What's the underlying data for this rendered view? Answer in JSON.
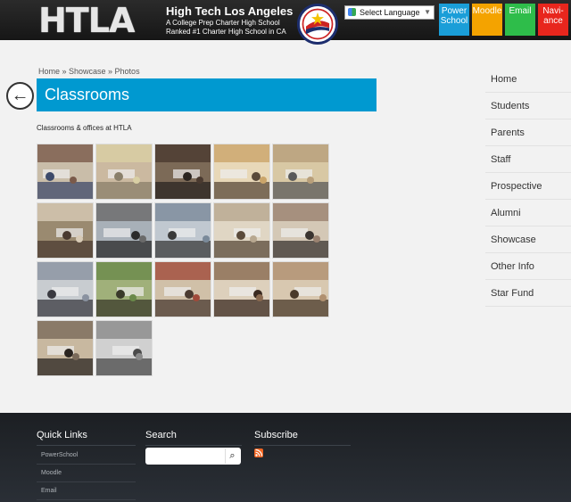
{
  "header": {
    "logo": "HTLA",
    "school_name": "High Tech Los Angeles",
    "tagline_1": "A College Prep Charter High School",
    "tagline_2": "Ranked #1 Charter High School in CA",
    "language_select": "Select Language",
    "quick_buttons": [
      "Power School",
      "Moodle",
      "Email",
      "Navi-ance"
    ]
  },
  "breadcrumb": "Home » Showcase » Photos",
  "page_title": "Classrooms",
  "description": "Classrooms & offices at HTLA",
  "thumbnails": [
    {
      "label": "classroom-1",
      "colors": [
        "#7a5a4a",
        "#c9bda9",
        "#3d4a6a"
      ]
    },
    {
      "label": "classroom-2",
      "colors": [
        "#d9cfa4",
        "#cbb9a0",
        "#8a7f6a"
      ]
    },
    {
      "label": "classroom-3",
      "colors": [
        "#4a3a30",
        "#7c6a57",
        "#2a2420"
      ]
    },
    {
      "label": "classroom-4",
      "colors": [
        "#caa56a",
        "#e8d8b8",
        "#5a4a3a"
      ]
    },
    {
      "label": "classroom-5",
      "colors": [
        "#b89f7a",
        "#d8c8a4",
        "#5a5a5a"
      ]
    },
    {
      "label": "classroom-6",
      "colors": [
        "#d8cbb6",
        "#9a8a70",
        "#4a3a30"
      ]
    },
    {
      "label": "classroom-7",
      "colors": [
        "#6a6a6a",
        "#a8b0b8",
        "#2a2a2a"
      ]
    },
    {
      "label": "classroom-8",
      "colors": [
        "#7a8a9a",
        "#c0c8d0",
        "#3a3a3a"
      ]
    },
    {
      "label": "classroom-9",
      "colors": [
        "#b8a890",
        "#e0d6c4",
        "#5a4a3a"
      ]
    },
    {
      "label": "classroom-10",
      "colors": [
        "#9a8270",
        "#d4c8b6",
        "#3a3430"
      ]
    },
    {
      "label": "classroom-11",
      "colors": [
        "#8a92a0",
        "#c8ccd0",
        "#3a3a40"
      ]
    },
    {
      "label": "classroom-12",
      "colors": [
        "#6a8a4a",
        "#a0b07a",
        "#3a3a2a"
      ]
    },
    {
      "label": "classroom-13",
      "colors": [
        "#a04a3a",
        "#d0c0a8",
        "#4a3a30"
      ]
    },
    {
      "label": "classroom-14",
      "colors": [
        "#8a6a50",
        "#ddd0bc",
        "#3a2a20"
      ]
    },
    {
      "label": "classroom-15",
      "colors": [
        "#b09070",
        "#d8c8b0",
        "#4a3a2a"
      ]
    },
    {
      "label": "classroom-16",
      "colors": [
        "#7a6a5a",
        "#c8b8a0",
        "#2a2420"
      ]
    },
    {
      "label": "classroom-17",
      "colors": [
        "#8a8a8a",
        "#d0d0d0",
        "#4a4a4a"
      ]
    }
  ],
  "sidenav": [
    "Home",
    "Students",
    "Parents",
    "Staff",
    "Prospective",
    "Alumni",
    "Showcase",
    "Other Info",
    "Star Fund"
  ],
  "footer": {
    "quick_links_title": "Quick Links",
    "quick_links": [
      "PowerSchool",
      "Moodle",
      "Email"
    ],
    "search_title": "Search",
    "search_placeholder": "",
    "subscribe_title": "Subscribe"
  },
  "colors": {
    "accent": "#0099d0",
    "powerschool": "#1a9ed8",
    "moodle": "#f4a300",
    "email": "#2ebd4a",
    "naviance": "#e8261d"
  }
}
